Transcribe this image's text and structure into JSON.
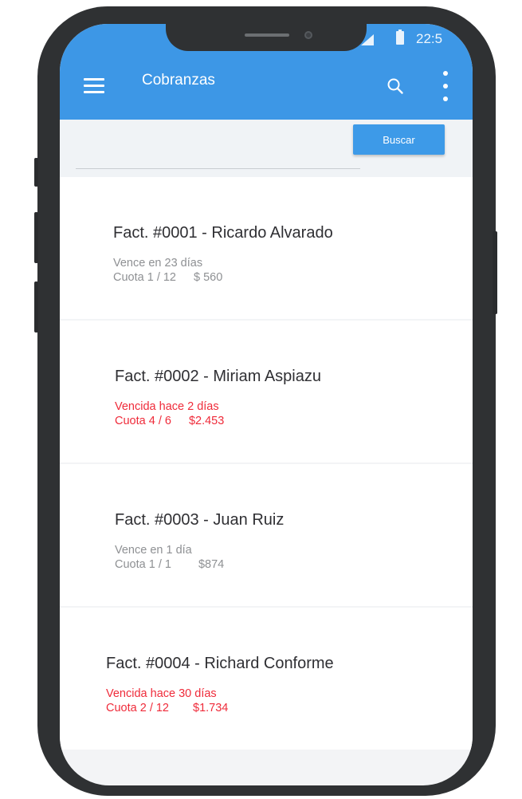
{
  "status_bar": {
    "time": "22:5"
  },
  "app_bar": {
    "title": "Cobranzas"
  },
  "search": {
    "button_label": "Buscar"
  },
  "invoices": [
    {
      "title": "Fact. #0001 - Ricardo Alvarado",
      "due_text": "Vence en 23 días",
      "installment": "Cuota 1 / 12",
      "amount": "$ 560",
      "overdue": false
    },
    {
      "title": "Fact. #0002 - Miriam Aspiazu",
      "due_text": "Vencida hace 2 días",
      "installment": "Cuota 4 / 6",
      "amount": "$2.453",
      "overdue": true
    },
    {
      "title": "Fact. #0003 - Juan Ruiz",
      "due_text": "Vence en 1 día",
      "installment": "Cuota 1 / 1",
      "amount": "$874",
      "overdue": false
    },
    {
      "title": "Fact. #0004 - Richard Conforme",
      "due_text": "Vencida hace 30 días",
      "installment": "Cuota 2 / 12",
      "amount": "$1.734",
      "overdue": true
    }
  ],
  "colors": {
    "primary": "#3d97e6",
    "overdue": "#ef2b3a",
    "muted": "#8e9093",
    "frame": "#2f3133"
  },
  "icons": [
    "menu-icon",
    "search-icon",
    "more-vertical-icon",
    "signal-icon",
    "battery-icon"
  ]
}
